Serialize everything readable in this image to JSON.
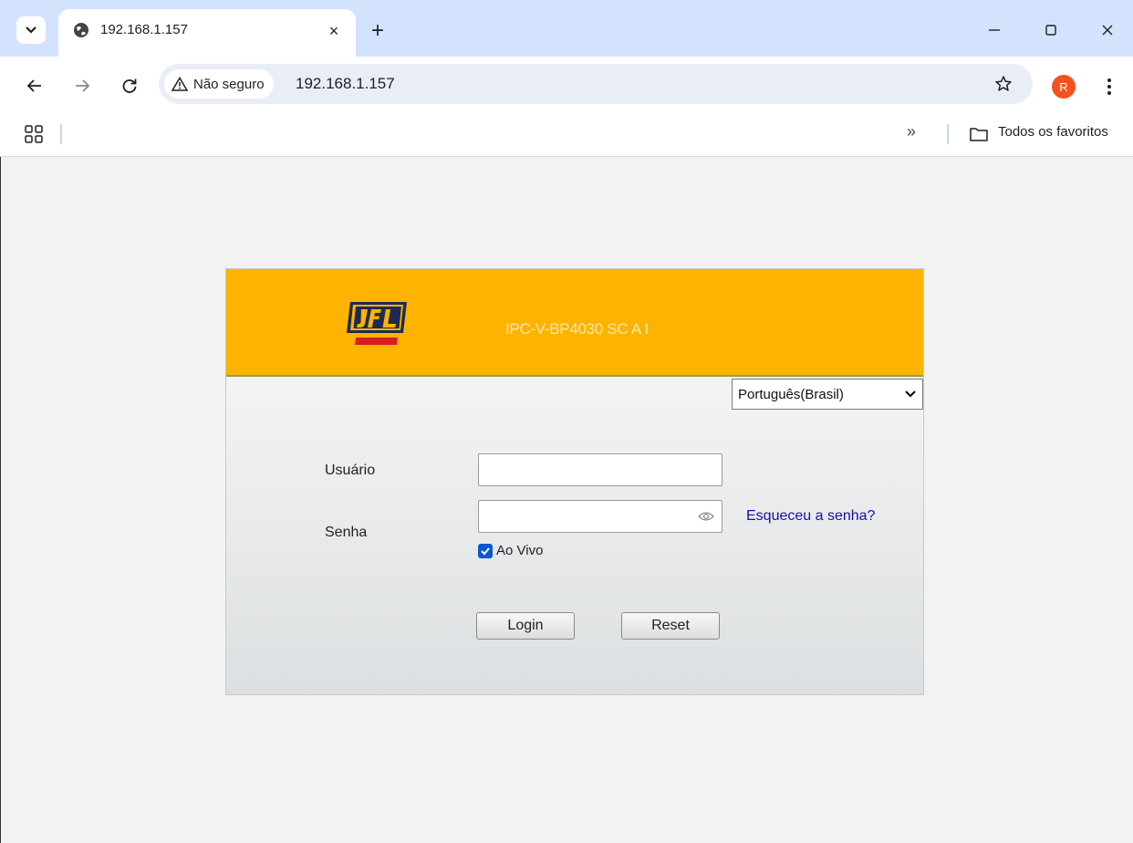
{
  "browser": {
    "tab_title": "192.168.1.157",
    "new_tab_symbol": "+",
    "close_tab_symbol": "×",
    "security_label": "Não seguro",
    "url": "192.168.1.157",
    "profile_initial": "R",
    "bookmarks_more": "»",
    "all_bookmarks_label": "Todos os favoritos",
    "icons": [
      "tab-search-icon",
      "globe-icon",
      "close-icon",
      "plus-icon",
      "minimize-icon",
      "maximize-icon",
      "window-close-icon",
      "back-icon",
      "forward-icon",
      "reload-icon",
      "warning-icon",
      "star-icon",
      "kebab-menu-icon",
      "apps-icon",
      "folder-icon"
    ]
  },
  "login": {
    "device_model": "IPC-V-BP4030 SC A I",
    "language_selected": "Português(Brasil)",
    "username_label": "Usuário",
    "password_label": "Senha",
    "username_value": "",
    "password_value": "",
    "forgot_password": "Esqueceu a senha?",
    "live_label": "Ao Vivo",
    "live_checked": true,
    "login_button": "Login",
    "reset_button": "Reset"
  },
  "colors": {
    "header_yellow": "#fdb300",
    "tabstrip_blue": "#d3e3fd",
    "link_blue": "#1a0dab",
    "checkbox_blue": "#0b57d0",
    "avatar_orange": "#f4511e"
  }
}
